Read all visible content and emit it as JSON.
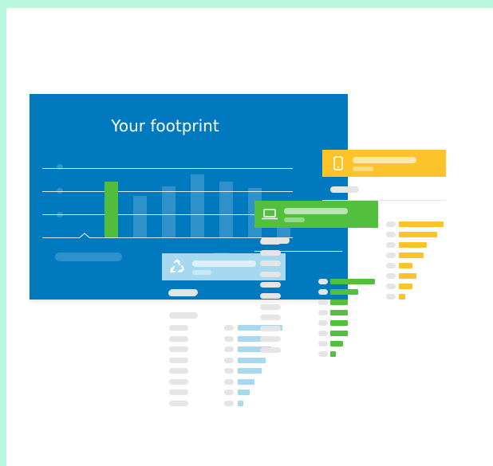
{
  "main_card": {
    "title": "Your footprint",
    "background": "#0079bf",
    "columns": [
      {
        "value": 64,
        "highlight": true
      },
      {
        "value": 47,
        "highlight": false
      },
      {
        "value": 58,
        "highlight": false
      },
      {
        "value": 72,
        "highlight": false
      },
      {
        "value": 64,
        "highlight": false
      },
      {
        "value": 56,
        "highlight": false
      },
      {
        "value": 42,
        "highlight": false
      }
    ],
    "highlight_color": "#52bd3c"
  },
  "category_cards": [
    {
      "icon": "phone-icon",
      "color": "#fcc42a"
    },
    {
      "icon": "laptop-icon",
      "color": "#52c03e"
    },
    {
      "icon": "recycle-icon",
      "color": "#a6d9ef"
    }
  ],
  "yellow_levels": [
    1.0,
    0.85,
    0.62,
    0.55,
    0.3,
    0.4,
    0.3,
    0.15
  ],
  "green_levels": [
    1.0,
    0.63,
    0.4,
    0.4,
    0.4,
    0.4,
    0.29,
    0.13
  ],
  "blue_levels": [
    1.0,
    0.88,
    0.75,
    0.63,
    0.54,
    0.38,
    0.27,
    0.13
  ]
}
